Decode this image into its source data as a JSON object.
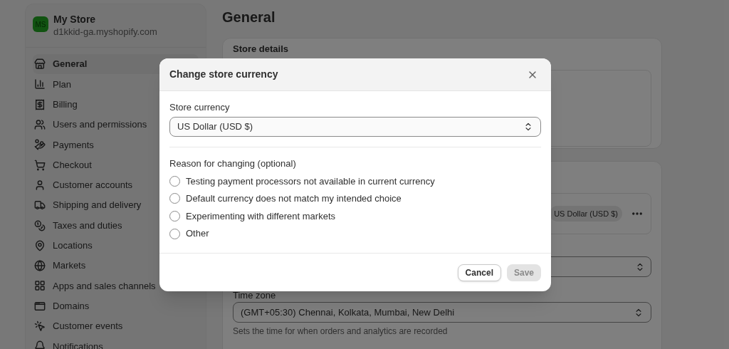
{
  "store": {
    "initials": "MS",
    "name": "My Store",
    "domain": "d1kkid-ga.myshopify.com"
  },
  "sidebar": {
    "items": [
      {
        "label": "General",
        "selected": true
      },
      {
        "label": "Plan",
        "selected": false
      },
      {
        "label": "Billing",
        "selected": false
      },
      {
        "label": "Users and permissions",
        "selected": false
      },
      {
        "label": "Payments",
        "selected": false
      },
      {
        "label": "Checkout",
        "selected": false
      },
      {
        "label": "Customer accounts",
        "selected": false
      },
      {
        "label": "Shipping and delivery",
        "selected": false
      },
      {
        "label": "Taxes and duties",
        "selected": false
      },
      {
        "label": "Locations",
        "selected": false
      },
      {
        "label": "Markets",
        "selected": false
      },
      {
        "label": "Apps and sales channels",
        "selected": false
      },
      {
        "label": "Domains",
        "selected": false
      },
      {
        "label": "Customer events",
        "selected": false
      },
      {
        "label": "Notifications",
        "selected": false
      }
    ]
  },
  "page": {
    "title": "General",
    "store_details": {
      "title": "Store details"
    },
    "defaults": {
      "currency_badge": "US Dollar (USD $)",
      "time_zone": {
        "label": "Time zone",
        "value": "(GMT+05:30) Chennai, Kolkata, Mumbai, New Delhi",
        "help": "Sets the time for when orders and analytics are recorded"
      }
    }
  },
  "modal": {
    "title": "Change store currency",
    "currency": {
      "label": "Store currency",
      "value": "US Dollar (USD $)"
    },
    "reason": {
      "label": "Reason for changing (optional)",
      "options": [
        {
          "label": "Testing payment processors not available in current currency",
          "selected": false
        },
        {
          "label": "Default currency does not match my intended choice",
          "selected": false
        },
        {
          "label": "Experimenting with different markets",
          "selected": false
        },
        {
          "label": "Other",
          "selected": false
        }
      ]
    },
    "buttons": [
      {
        "label": "Cancel",
        "kind": "secondary",
        "disabled": false
      },
      {
        "label": "Save",
        "kind": "primary",
        "disabled": true
      }
    ]
  }
}
